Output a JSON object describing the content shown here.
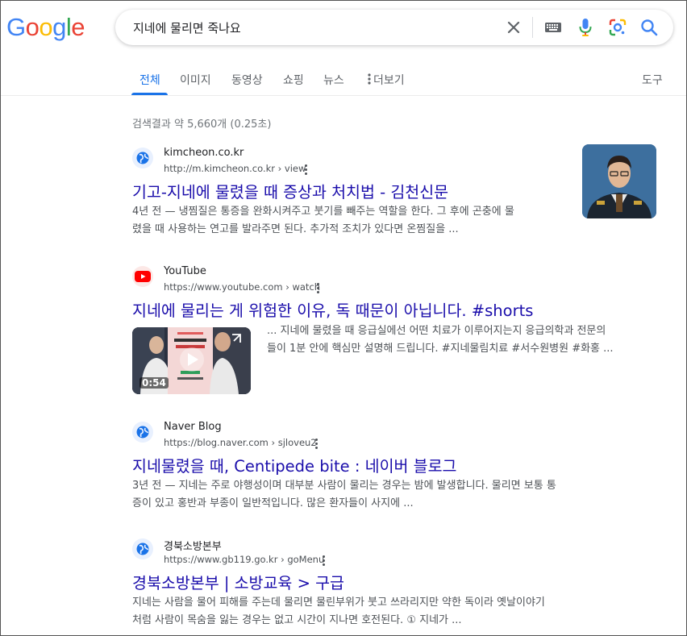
{
  "search": {
    "query": "지네에 물리면 죽나요"
  },
  "tabs": [
    {
      "label": "전체"
    },
    {
      "label": "이미지"
    },
    {
      "label": "동영상"
    },
    {
      "label": "쇼핑"
    },
    {
      "label": "뉴스"
    },
    {
      "label": "더보기"
    }
  ],
  "tools_label": "도구",
  "stats": "검색결과 약 5,660개 (0.25초)",
  "results": [
    {
      "site": "kimcheon.co.kr",
      "url": "http://m.kimcheon.co.kr › view",
      "title": "기고-지네에 물렸을 때 증상과 처치법 - 김천신문",
      "snippet_lines": [
        "4년 전 — 냉찜질은 통증을 완화시켜주고 붓기를 빼주는 역할을 한다. 그 후에 곤충에 물",
        "렸을 때 사용하는 연고를 발라주면 된다. 추가적 조치가 있다면 온찜질을 ..."
      ]
    },
    {
      "site": "YouTube",
      "url": "https://www.youtube.com › watch",
      "title": "지네에 물리는 게 위험한 이유, 독 때문이 아닙니다. #shorts",
      "video_duration": "0:54",
      "snippet_lines": [
        "... 지네에 물렸을 때 응급실에선 어떤 치료가 이루어지는지 응급의학과 전문의",
        "들이 1분 안에 핵심만 설명해 드립니다. #지네물림치료 #서수원병원 #화홍 ..."
      ]
    },
    {
      "site": "Naver Blog",
      "url": "https://blog.naver.com › sjloveu2",
      "title": "지네물렸을 때, Centipede bite : 네이버 블로그",
      "snippet_lines": [
        "3년 전 — 지네는 주로 야행성이며 대부분 사람이 물리는 경우는 밤에 발생합니다. 물리면 보통 통",
        "증이 있고 홍반과 부종이 일반적입니다. 많은 환자들이 사지에 ..."
      ]
    },
    {
      "site": "경북소방본부",
      "url": "https://www.gb119.go.kr › goMenu",
      "title": "경북소방본부 | 소방교육 > 구급",
      "snippet_lines": [
        "지네는 사람을 물어 피해를 주는데 물리면 물린부위가 붓고 쓰라리지만 약한 독이라 옛날이야기",
        "처럼 사람이 목숨을 잃는 경우는 없고 시간이 지나면 호전된다. ① 지네가 ..."
      ]
    }
  ],
  "colors": {
    "link_title": "#1a0dab",
    "accent_blue": "#1a73e8",
    "youtube_red": "#ff0000"
  }
}
